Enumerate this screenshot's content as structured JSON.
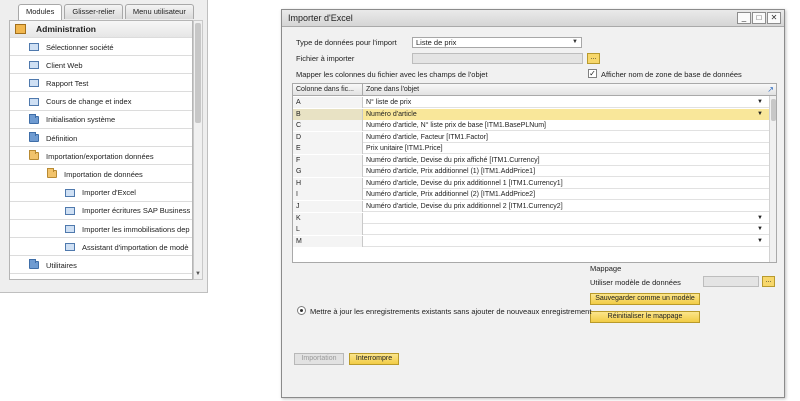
{
  "modules": {
    "tabs": [
      "Modules",
      "Glisser-relier",
      "Menu utilisateur"
    ],
    "active_tab": 0,
    "header": "Administration",
    "items": [
      {
        "label": "Sélectionner société",
        "icon": "document-icon"
      },
      {
        "label": "Client Web",
        "icon": "document-icon"
      },
      {
        "label": "Rapport Test",
        "icon": "document-icon"
      },
      {
        "label": "Cours de change et index",
        "icon": "document-icon"
      },
      {
        "label": "Initialisation système",
        "icon": "folder-icon"
      },
      {
        "label": "Définition",
        "icon": "folder-icon"
      },
      {
        "label": "Importation/exportation données",
        "icon": "folder-open-icon"
      },
      {
        "label": "Importation de données",
        "icon": "folder-open-icon"
      },
      {
        "label": "Importer d'Excel",
        "icon": "document-icon"
      },
      {
        "label": "Importer écritures SAP Business",
        "icon": "document-icon"
      },
      {
        "label": "Importer les immobilisations dep",
        "icon": "document-icon"
      },
      {
        "label": "Assistant d'importation de modè",
        "icon": "document-icon"
      },
      {
        "label": "Utilitaires",
        "icon": "folder-icon"
      }
    ]
  },
  "dialog": {
    "title": "Importer d'Excel",
    "window_buttons": {
      "minimize": "_",
      "maximize": "□",
      "close": "✕"
    },
    "type_label": "Type de données pour l'import",
    "type_value": "Liste de prix",
    "file_label": "Fichier à importer",
    "file_value": "",
    "ellipsis": "...",
    "map_label": "Mapper les colonnes du fichier avec les champs de l'objet",
    "show_db_label": "Afficher nom de zone de base de données",
    "show_db_checked": "✓",
    "grid": {
      "col1": "Colonne dans fic...",
      "col2": "Zone dans l'objet",
      "rows": [
        {
          "col": "A",
          "field": "N° liste de prix",
          "dropdown": true
        },
        {
          "col": "B",
          "field": "Numéro d'article",
          "dropdown": true,
          "selected": true
        },
        {
          "col": "C",
          "field": "Numéro d'article, N° liste prix de base [ITM1.BasePLNum]",
          "dropdown": false
        },
        {
          "col": "D",
          "field": "Numéro d'article, Facteur [ITM1.Factor]",
          "dropdown": false
        },
        {
          "col": "E",
          "field": "Prix unitaire [ITM1.Price]",
          "dropdown": false
        },
        {
          "col": "F",
          "field": "Numéro d'article, Devise du prix affiché [ITM1.Currency]",
          "dropdown": false
        },
        {
          "col": "G",
          "field": "Numéro d'article, Prix additionnel (1) [ITM1.AddPrice1]",
          "dropdown": false
        },
        {
          "col": "H",
          "field": "Numéro d'article, Devise du prix additionnel 1 [ITM1.Currency1]",
          "dropdown": false
        },
        {
          "col": "I",
          "field": "Numéro d'article, Prix additionnel (2) [ITM1.AddPrice2]",
          "dropdown": false
        },
        {
          "col": "J",
          "field": "Numéro d'article, Devise du prix additionnel 2 [ITM1.Currency2]",
          "dropdown": false
        },
        {
          "col": "K",
          "field": "",
          "dropdown": true
        },
        {
          "col": "L",
          "field": "",
          "dropdown": true
        },
        {
          "col": "M",
          "field": "",
          "dropdown": true
        }
      ]
    },
    "mapping_title": "Mappage",
    "use_model_label": "Utiliser modèle de données",
    "save_model_button": "Sauvegarder comme un modèle",
    "reset_mapping_button": "Réinitialiser le mappage",
    "update_radio_label": "Mettre à jour les enregistrements existants sans ajouter de nouveaux enregistrement",
    "import_button": "Importation",
    "stop_button": "Interrompre"
  }
}
